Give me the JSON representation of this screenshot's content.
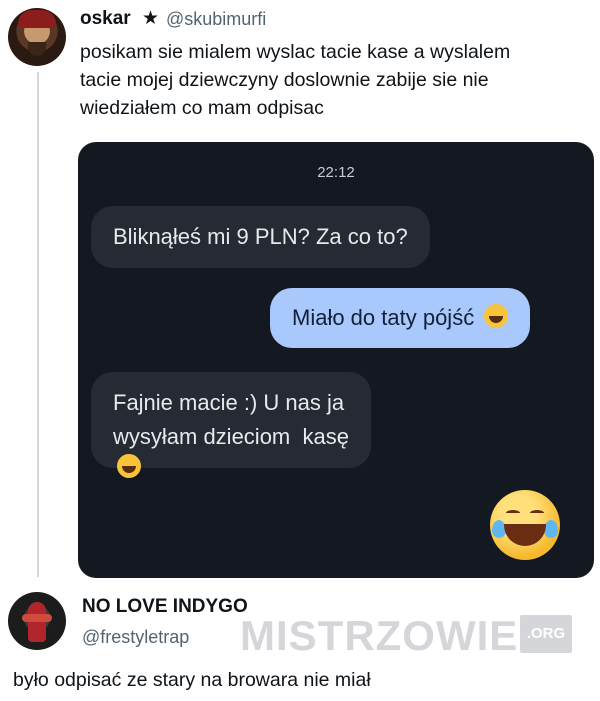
{
  "tweet": {
    "author_name": "oskar",
    "badge_glyph": "★",
    "handle": "@skubimurfi",
    "text_lines": [
      "posikam sie mialem wyslac tacie kase a wyslalem",
      "tacie mojej dziewczyny doslownie zabije sie nie",
      "wiedziałem co mam odpisac"
    ],
    "avatar_icon": "user-avatar-icon"
  },
  "screenshot": {
    "time": "22:12",
    "messages": [
      {
        "side": "received",
        "text": "Bliknąłeś mi 9 PLN? Za co to?"
      },
      {
        "side": "sent",
        "text": "Miało do taty pójść",
        "emoji": "grinning-sweat-emoji"
      },
      {
        "side": "received",
        "lines": [
          "Fajnie macie :) U nas ja",
          "wysyłam dzieciom  kasę"
        ],
        "emoji": "tears-of-joy-emoji"
      }
    ],
    "standalone_emoji": "tears-of-joy-emoji",
    "colors": {
      "background": "#141821",
      "received_bubble": "#262a33",
      "sent_bubble": "#a9c8fb"
    }
  },
  "reply": {
    "author_name": "NO LOVE INDYGO",
    "handle": "@frestyletrap",
    "text": "było odpisać ze stary na browara nie miał",
    "avatar_icon": "user-avatar-icon"
  },
  "watermark": {
    "text": "MISTRZOWIE",
    "suffix": ".ORG"
  }
}
